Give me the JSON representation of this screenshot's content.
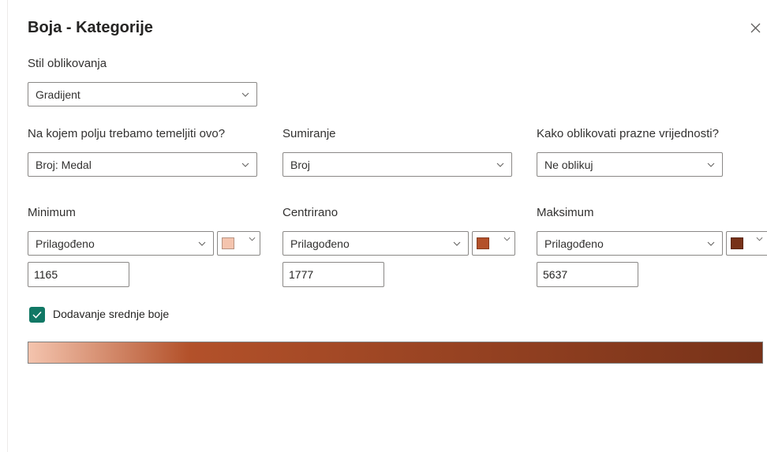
{
  "dialog": {
    "title": "Boja - Kategorije"
  },
  "style_section": {
    "label": "Stil oblikovanja",
    "value": "Gradijent"
  },
  "field_section": {
    "label": "Na kojem polju trebamo temeljiti ovo?",
    "value": "Broj: Medal"
  },
  "summary_section": {
    "label": "Sumiranje",
    "value": "Broj"
  },
  "empty_section": {
    "label": "Kako oblikovati prazne vrijednosti?",
    "value": "Ne oblikuj"
  },
  "minimum": {
    "label": "Minimum",
    "type": "Prilagođeno",
    "color": "#f4c4ae",
    "value": "1165"
  },
  "center": {
    "label": "Centrirano",
    "type": "Prilagođeno",
    "color": "#b3512a",
    "value": "1777"
  },
  "maximum": {
    "label": "Maksimum",
    "type": "Prilagođeno",
    "color": "#773219",
    "value": "5637"
  },
  "middle_color": {
    "label": "Dodavanje srednje boje",
    "checked": true
  },
  "colors": {
    "checkbox": "#117865",
    "border": "#8a8886"
  },
  "icons": [
    "close-icon",
    "chevron-down-icon",
    "checkmark-icon"
  ]
}
